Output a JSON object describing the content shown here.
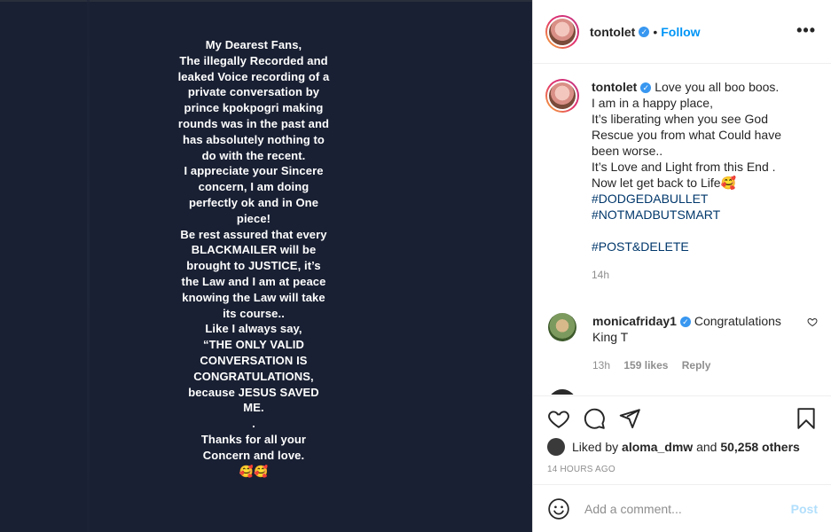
{
  "story": {
    "text": "My Dearest Fans,\nThe illegally Recorded and leaked Voice recording of a private conversation by prince kpokpogri making rounds was in the past and has absolutely nothing to do with the recent.\nI appreciate your Sincere concern, I am doing perfectly ok and in One piece!\nBe rest assured that every BLACKMAILER will be brought to JUSTICE, it’s the Law and I am at peace knowing the Law will take its course..\nLike I always say,\n“THE ONLY VALID CONVERSATION IS CONGRATULATIONS, because JESUS SAVED ME.\n.\nThanks for all your Concern and love.\n🥰🥰"
  },
  "header": {
    "username": "tontolet",
    "verified_glyph": "✓",
    "dot": "•",
    "follow_label": "Follow",
    "more_label": "•••"
  },
  "caption": {
    "username": "tontolet",
    "lines": [
      "Love you all boo boos.",
      "I am in a happy place,",
      "It’s liberating when you see God Rescue you from what Could have been worse..",
      "It’s Love and Light from this End .",
      "Now let get back to Life🥰"
    ],
    "hashtags": [
      "#DODGEDABULLET",
      "#NOTMADBUTSMART",
      "",
      "#POST&DELETE"
    ],
    "time": "14h"
  },
  "comment1": {
    "username": "monicafriday1",
    "text": "Congratulations King T",
    "time": "13h",
    "likes": "159 likes",
    "reply_label": "Reply"
  },
  "comment2": {
    "username": "…",
    "text": "❤️❤️❤️"
  },
  "likes": {
    "prefix": "Liked by",
    "user": "aloma_dmw",
    "middle": "and",
    "others": "50,258 others"
  },
  "timestamp": "14 HOURS AGO",
  "composer": {
    "placeholder": "Add a comment...",
    "post_label": "Post"
  },
  "icons": [
    "heart-icon",
    "comment-icon",
    "share-icon",
    "bookmark-icon",
    "emoji-icon",
    "more-icon",
    "verified-icon"
  ],
  "colors": {
    "accent": "#0095f6",
    "story_bg": "#192033",
    "verified": "#3897f0",
    "hashtag": "#00376b"
  }
}
